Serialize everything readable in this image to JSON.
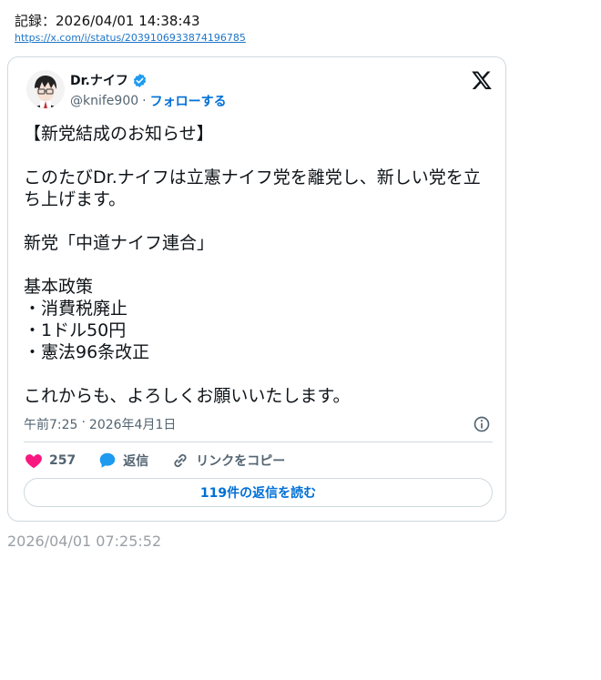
{
  "record": {
    "label": "記録：2026/04/01 14:38:43"
  },
  "source": {
    "url": "https://x.com/i/status/2039106933874196785"
  },
  "tweet": {
    "author": {
      "name": "Dr.ナイフ",
      "handle": "@knife900",
      "separator": "·",
      "follow_label": "フォローする"
    },
    "text": "【新党結成のお知らせ】\n\nこのたびDr.ナイフは立憲ナイフ党を離党し、新しい党を立ち上げます。\n\n新党「中道ナイフ連合」\n\n基本政策\n・消費税廃止\n・1ドル50円\n・憲法96条改正\n\nこれからも、よろしくお願いいたします。",
    "time": "午前7:25",
    "date": "2026年4月1日",
    "time_separator": "·",
    "likes": "257",
    "reply_label": "返信",
    "copy_link_label": "リンクをコピー",
    "read_replies_label": "119件の返信を読む"
  },
  "footer": {
    "timestamp": "2026/04/01 07:25:52"
  },
  "colors": {
    "accent": "#1d9bf0",
    "link": "#006fd6",
    "like": "#f91880",
    "border": "#cfd9de"
  },
  "icons": {
    "verified": "verified-badge-icon",
    "x": "x-logo-icon",
    "info": "info-icon",
    "like": "heart-icon",
    "reply": "speech-bubble-icon",
    "copy": "link-icon"
  }
}
